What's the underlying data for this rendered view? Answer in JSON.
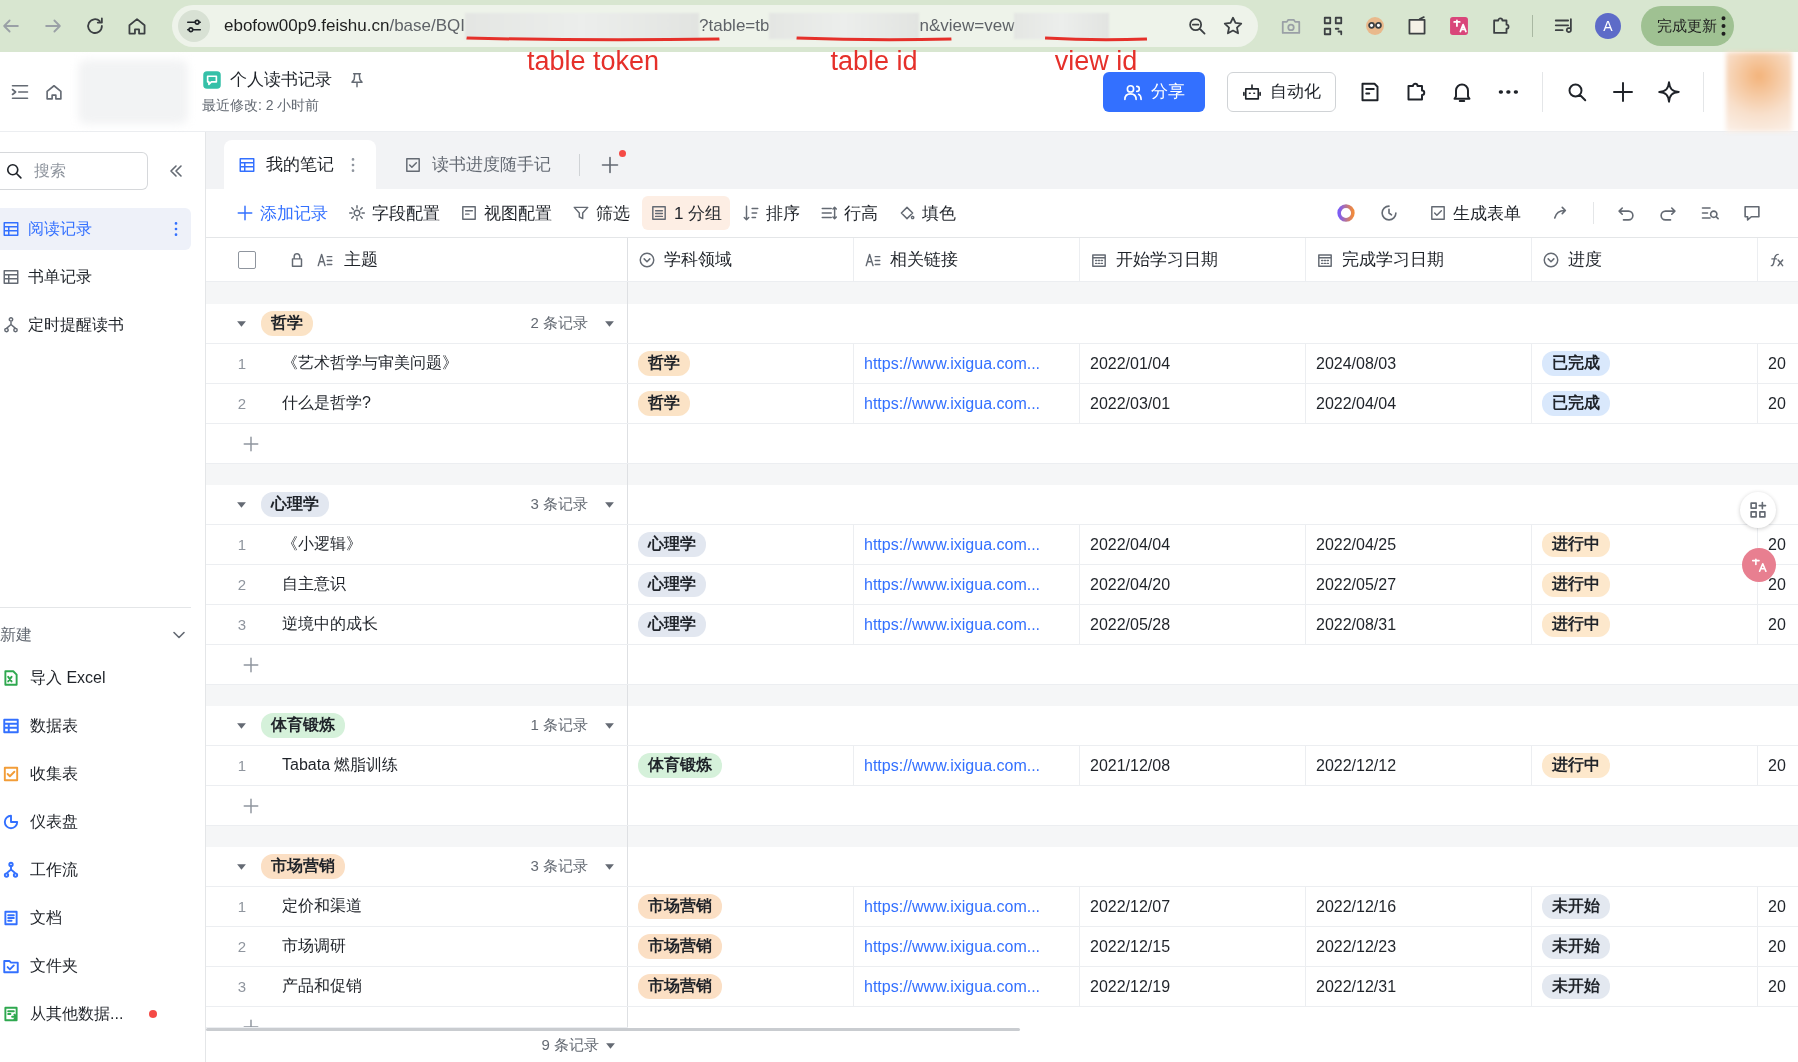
{
  "browser": {
    "url_parts": [
      {
        "kind": "host",
        "text": "ebofow00p9.feishu.cn"
      },
      {
        "kind": "path",
        "text": "/base/BQI"
      },
      {
        "kind": "redacted"
      },
      {
        "kind": "path",
        "text": "?table=tb"
      },
      {
        "kind": "redacted"
      },
      {
        "kind": "path",
        "text": "n&view=vew"
      },
      {
        "kind": "redacted"
      }
    ],
    "profile_initial": "A",
    "update_button": "完成更新"
  },
  "annotations": [
    {
      "text": "table token"
    },
    {
      "text": "table id"
    },
    {
      "text": "view id"
    }
  ],
  "header": {
    "title": "个人读书记录",
    "subtitle": "最近修改: 2 小时前",
    "share_button": "分享",
    "automation_button": "自动化"
  },
  "sidebar": {
    "search_placeholder": "搜索",
    "tables": [
      {
        "label": "阅读记录",
        "kind": "table",
        "selected": true
      },
      {
        "label": "书单记录",
        "kind": "table",
        "selected": false
      },
      {
        "label": "定时提醒读书",
        "kind": "workflow",
        "selected": false
      }
    ],
    "new_section": {
      "title": "新建",
      "expanded": true
    },
    "create_items": [
      {
        "label": "导入 Excel",
        "kind": "excel",
        "color": "#2fa84f",
        "unread": false
      },
      {
        "label": "数据表",
        "kind": "table",
        "color": "#3370ff",
        "unread": false
      },
      {
        "label": "收集表",
        "kind": "form",
        "color": "#f29d38",
        "unread": false
      },
      {
        "label": "仪表盘",
        "kind": "dashboard",
        "color": "#3370ff",
        "unread": false
      },
      {
        "label": "工作流",
        "kind": "workflow",
        "color": "#3370ff",
        "unread": false
      },
      {
        "label": "文档",
        "kind": "doc",
        "color": "#3370ff",
        "unread": false
      },
      {
        "label": "文件夹",
        "kind": "folder",
        "color": "#3370ff",
        "unread": false
      },
      {
        "label": "从其他数据...",
        "kind": "import",
        "color": "#2fa84f",
        "unread": true
      }
    ]
  },
  "tabs": [
    {
      "label": "我的笔记",
      "kind": "table",
      "selected": true
    },
    {
      "label": "读书进度随手记",
      "kind": "form",
      "selected": false
    }
  ],
  "toolbar": {
    "items": [
      {
        "label": "添加记录",
        "kind": "add",
        "active": false
      },
      {
        "label": "字段配置",
        "kind": "gear",
        "active": false
      },
      {
        "label": "视图配置",
        "kind": "view",
        "active": false
      },
      {
        "label": "筛选",
        "kind": "filter",
        "active": false
      },
      {
        "label": "1 分组",
        "kind": "group",
        "active": true
      },
      {
        "label": "排序",
        "kind": "sort",
        "active": false
      },
      {
        "label": "行高",
        "kind": "rowheight",
        "active": false
      },
      {
        "label": "填色",
        "kind": "fill",
        "active": false
      }
    ],
    "form_button": "生成表单"
  },
  "table": {
    "select_all": {
      "checked": false
    },
    "columns": [
      {
        "label": "主题",
        "kind": "text",
        "locked": true
      },
      {
        "label": "学科领域",
        "kind": "select",
        "locked": false
      },
      {
        "label": "相关链接",
        "kind": "text",
        "locked": false
      },
      {
        "label": "开始学习日期",
        "kind": "date",
        "locked": false
      },
      {
        "label": "完成学习日期",
        "kind": "date",
        "locked": false
      },
      {
        "label": "进度",
        "kind": "select",
        "locked": false
      },
      {
        "kind": "formula",
        "locked": false
      }
    ],
    "groups": [
      {
        "name": "哲学",
        "color": "#fbe3c6",
        "count": "2 条记录",
        "expanded": true,
        "rows": [
          {
            "index": "1",
            "title": "《艺术哲学与审美问题》",
            "subject": {
              "label": "哲学",
              "color": "#fbe3c6"
            },
            "link": "https://www.ixigua.com...",
            "start": "2022/01/04",
            "end": "2024/08/03",
            "status": {
              "label": "已完成",
              "color": "#d9e8fc"
            },
            "column_7": "20"
          },
          {
            "index": "2",
            "title": "什么是哲学?",
            "subject": {
              "label": "哲学",
              "color": "#fbe3c6"
            },
            "link": "https://www.ixigua.com...",
            "start": "2022/03/01",
            "end": "2022/04/04",
            "status": {
              "label": "已完成",
              "color": "#d9e8fc"
            },
            "column_7": "20"
          }
        ]
      },
      {
        "name": "心理学",
        "color": "#e2e7f0",
        "count": "3 条记录",
        "expanded": true,
        "rows": [
          {
            "index": "1",
            "title": "《小逻辑》",
            "subject": {
              "label": "心理学",
              "color": "#e2e7f0"
            },
            "link": "https://www.ixigua.com...",
            "start": "2022/04/04",
            "end": "2022/04/25",
            "status": {
              "label": "进行中",
              "color": "#fde8cc"
            },
            "column_7": "20"
          },
          {
            "index": "2",
            "title": "自主意识",
            "subject": {
              "label": "心理学",
              "color": "#e2e7f0"
            },
            "link": "https://www.ixigua.com...",
            "start": "2022/04/20",
            "end": "2022/05/27",
            "status": {
              "label": "进行中",
              "color": "#fde8cc"
            },
            "column_7": "20"
          },
          {
            "index": "3",
            "title": "逆境中的成长",
            "subject": {
              "label": "心理学",
              "color": "#e2e7f0"
            },
            "link": "https://www.ixigua.com...",
            "start": "2022/05/28",
            "end": "2022/08/31",
            "status": {
              "label": "进行中",
              "color": "#fde8cc"
            },
            "column_7": "20"
          }
        ]
      },
      {
        "name": "体育锻炼",
        "color": "#d5f1da",
        "count": "1 条记录",
        "expanded": true,
        "rows": [
          {
            "index": "1",
            "title": "Tabata 燃脂训练",
            "subject": {
              "label": "体育锻炼",
              "color": "#d5f1da"
            },
            "link": "https://www.ixigua.com...",
            "start": "2021/12/08",
            "end": "2022/12/12",
            "status": {
              "label": "进行中",
              "color": "#fde8cc"
            },
            "column_7": "20"
          }
        ]
      },
      {
        "name": "市场营销",
        "color": "#fbdfc4",
        "count": "3 条记录",
        "expanded": true,
        "rows": [
          {
            "index": "1",
            "title": "定价和渠道",
            "subject": {
              "label": "市场营销",
              "color": "#fbdfc4"
            },
            "link": "https://www.ixigua.com...",
            "start": "2022/12/07",
            "end": "2022/12/16",
            "status": {
              "label": "未开始",
              "color": "#e3e8f0"
            },
            "column_7": "20"
          },
          {
            "index": "2",
            "title": "市场调研",
            "subject": {
              "label": "市场营销",
              "color": "#fbdfc4"
            },
            "link": "https://www.ixigua.com...",
            "start": "2022/12/15",
            "end": "2022/12/23",
            "status": {
              "label": "未开始",
              "color": "#e3e8f0"
            },
            "column_7": "20"
          },
          {
            "index": "3",
            "title": "产品和促销",
            "subject": {
              "label": "市场营销",
              "color": "#fbdfc4"
            },
            "link": "https://www.ixigua.com...",
            "start": "2022/12/19",
            "end": "2022/12/31",
            "status": {
              "label": "未开始",
              "color": "#e3e8f0"
            },
            "column_7": "20"
          }
        ]
      }
    ],
    "footer": "9 条记录"
  }
}
